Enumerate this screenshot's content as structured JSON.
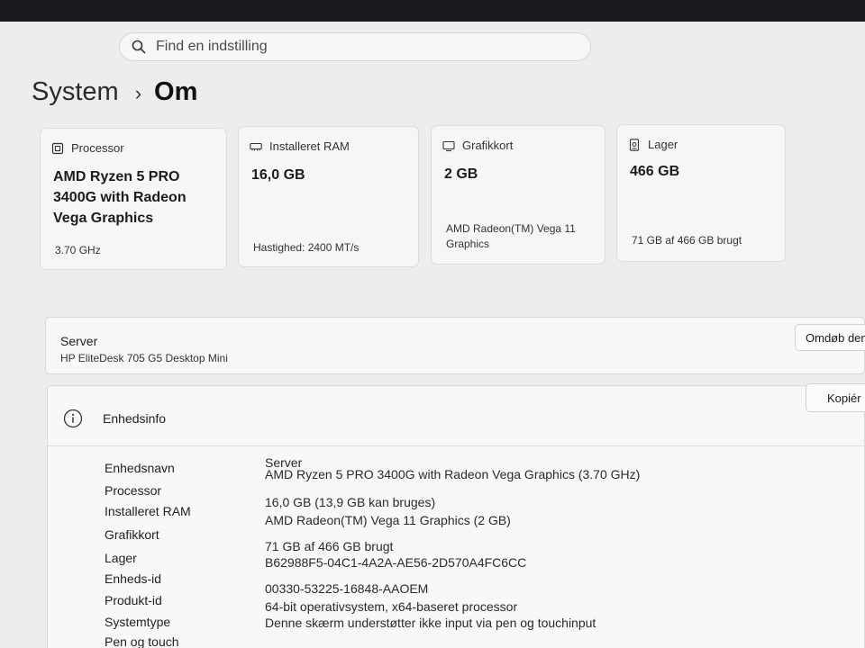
{
  "search": {
    "placeholder": "Find en indstilling"
  },
  "breadcrumb": {
    "parent": "System",
    "separator": "›",
    "current": "Om"
  },
  "cards": [
    {
      "title": "Processor",
      "value_lines": [
        "AMD Ryzen 5 PRO",
        "3400G with Radeon",
        "Vega Graphics"
      ],
      "sub_lines": [
        "3.70 GHz"
      ]
    },
    {
      "title": "Installeret RAM",
      "value_lines": [
        "16,0 GB"
      ],
      "sub_lines": [
        "Hastighed: 2400 MT/s"
      ]
    },
    {
      "title": "Grafikkort",
      "value_lines": [
        "2 GB"
      ],
      "sub_lines": [
        "AMD Radeon(TM) Vega 11",
        "Graphics"
      ]
    },
    {
      "title": "Lager",
      "value_lines": [
        "466 GB"
      ],
      "sub_lines": [
        "71 GB af 466 GB brugt"
      ]
    }
  ],
  "device": {
    "name": "Server",
    "model": "HP EliteDesk 705 G5 Desktop Mini",
    "rename_label": "Omdøb den"
  },
  "specs": {
    "title": "Enhedsinfo",
    "copy_label": "Kopiér",
    "rows": [
      {
        "label": "Enhedsnavn",
        "value": "Server"
      },
      {
        "label": "Processor",
        "value": "AMD Ryzen 5 PRO 3400G with Radeon Vega Graphics (3.70 GHz)"
      },
      {
        "label": "Installeret RAM",
        "value": "16,0 GB (13,9 GB kan bruges)"
      },
      {
        "label": "Grafikkort",
        "value": "AMD Radeon(TM) Vega 11 Graphics (2 GB)"
      },
      {
        "label": "Lager",
        "value": "71 GB af 466 GB brugt"
      },
      {
        "label": "Enheds-id",
        "value": "B62988F5-04C1-4A2A-AE56-2D570A4FC6CC"
      },
      {
        "label": "Produkt-id",
        "value": "00330-53225-16848-AAOEM"
      },
      {
        "label": "Systemtype",
        "value": "64-bit operativsystem, x64-baseret processor"
      },
      {
        "label": "Pen og touch",
        "value": "Denne skærm understøtter ikke input via pen og touchinput"
      }
    ]
  }
}
